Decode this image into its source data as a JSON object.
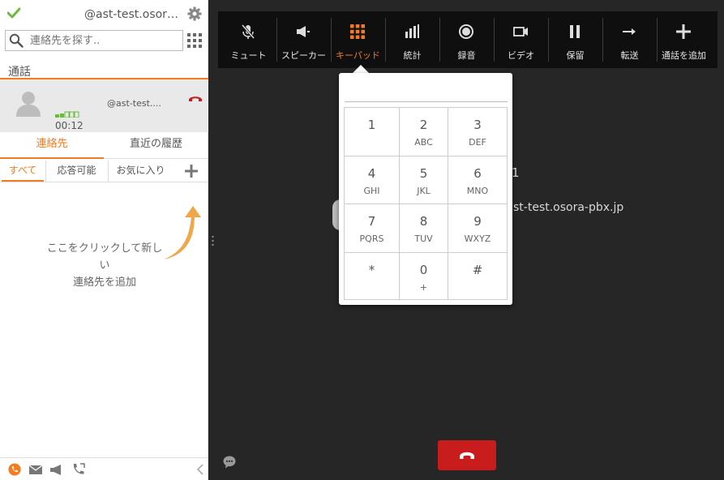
{
  "colors": {
    "accent": "#f47b20",
    "online": "#6cbb3c",
    "hangup": "#c91c1c",
    "dark_bg": "#262626",
    "toolbar_bg": "#0f0f0f"
  },
  "sidebar": {
    "account_name": "@ast-test.osora...",
    "search_placeholder": "連絡先を探す..",
    "calls_header": "通話",
    "active_call": {
      "name": "@ast-test....",
      "timer": "00:12"
    },
    "tabs": [
      {
        "label": "連絡先",
        "active": true
      },
      {
        "label": "直近の履歴",
        "active": false
      }
    ],
    "subtabs": [
      {
        "label": "すべて",
        "active": true
      },
      {
        "label": "応答可能",
        "active": false
      },
      {
        "label": "お気に入り",
        "active": false
      }
    ],
    "hint_line1": "ここをクリックして新しい",
    "hint_line2": "連絡先を追加",
    "bottom_icons": [
      "phone-icon",
      "mail-icon",
      "megaphone-icon",
      "phone-forward-icon",
      "collapse-left-icon"
    ]
  },
  "toolbar": {
    "items": [
      {
        "label": "ミュート",
        "icon": "mic-off-icon"
      },
      {
        "label": "スピーカー",
        "icon": "speaker-icon"
      },
      {
        "label": "キーパッド",
        "icon": "keypad-icon",
        "active": true
      },
      {
        "label": "統計",
        "icon": "stats-icon"
      },
      {
        "label": "録音",
        "icon": "record-icon"
      },
      {
        "label": "ビデオ",
        "icon": "video-icon"
      },
      {
        "label": "保留",
        "icon": "pause-icon"
      },
      {
        "label": "転送",
        "icon": "transfer-icon"
      },
      {
        "label": "通話を追加",
        "icon": "plus-icon"
      }
    ]
  },
  "call_info": {
    "partial_digit": "1",
    "partial_address": "st-test.osora-pbx.jp"
  },
  "keypad": {
    "keys": [
      {
        "digit": "1",
        "letters": ""
      },
      {
        "digit": "2",
        "letters": "ABC"
      },
      {
        "digit": "3",
        "letters": "DEF"
      },
      {
        "digit": "4",
        "letters": "GHI"
      },
      {
        "digit": "5",
        "letters": "JKL"
      },
      {
        "digit": "6",
        "letters": "MNO"
      },
      {
        "digit": "7",
        "letters": "PQRS"
      },
      {
        "digit": "8",
        "letters": "TUV"
      },
      {
        "digit": "9",
        "letters": "WXYZ"
      },
      {
        "digit": "*",
        "letters": ""
      },
      {
        "digit": "0",
        "letters": "+"
      },
      {
        "digit": "#",
        "letters": ""
      }
    ]
  }
}
